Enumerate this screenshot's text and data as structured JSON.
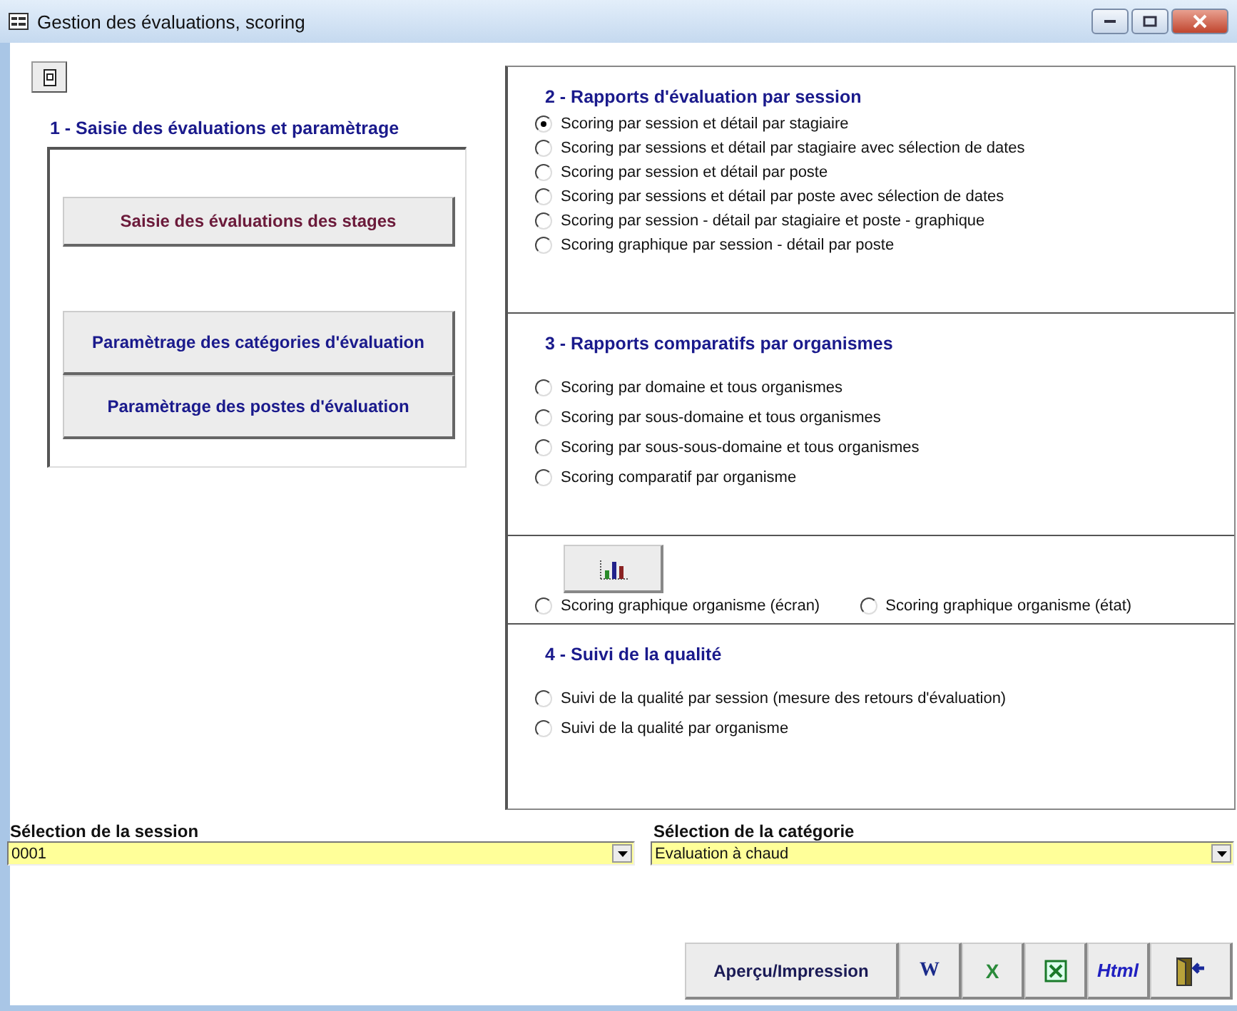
{
  "window": {
    "title": "Gestion des évaluations, scoring"
  },
  "left": {
    "title": "1 - Saisie des évaluations et paramètrage",
    "buttons": [
      {
        "label": "Saisie des évaluations des stages",
        "kind": "accent"
      },
      {
        "label": "Paramètrage des catégories d'évaluation",
        "kind": "normal"
      },
      {
        "label": "Paramètrage des postes d'évaluation",
        "kind": "normal"
      }
    ]
  },
  "sections": [
    {
      "kind": "list",
      "title": "2 - Rapports d'évaluation par session",
      "options": [
        {
          "label": "Scoring par session et détail par stagiaire",
          "selected": true
        },
        {
          "label": "Scoring par sessions et détail par stagiaire avec sélection de dates",
          "selected": false
        },
        {
          "label": "Scoring par session et détail par poste",
          "selected": false
        },
        {
          "label": "Scoring par sessions et détail par poste avec sélection de dates",
          "selected": false
        },
        {
          "label": "Scoring par session - détail par stagiaire et poste - graphique",
          "selected": false
        },
        {
          "label": "Scoring graphique par session - détail par poste",
          "selected": false
        }
      ]
    },
    {
      "kind": "list",
      "title": "3 - Rapports comparatifs par organismes",
      "options": [
        {
          "label": "Scoring par domaine et tous organismes",
          "selected": false
        },
        {
          "label": "Scoring par sous-domaine et tous organismes",
          "selected": false
        },
        {
          "label": "Scoring par sous-sous-domaine et tous organismes",
          "selected": false
        },
        {
          "label": "Scoring comparatif par organisme",
          "selected": false
        }
      ]
    },
    {
      "kind": "graph",
      "options": [
        {
          "label": "Scoring graphique organisme (écran)",
          "selected": false
        },
        {
          "label": "Scoring graphique organisme (état)",
          "selected": false
        }
      ]
    },
    {
      "kind": "list",
      "title": "4 - Suivi de la qualité",
      "options": [
        {
          "label": "Suivi de la qualité par session (mesure des retours d'évaluation)",
          "selected": false
        },
        {
          "label": "Suivi de la qualité par organisme",
          "selected": false
        }
      ]
    }
  ],
  "selects": [
    {
      "label": "Sélection de la session",
      "value": "0001"
    },
    {
      "label": "Sélection de la catégorie",
      "value": "Evaluation à chaud"
    }
  ],
  "actions": [
    {
      "kind": "text",
      "label": "Aperçu/Impression"
    },
    {
      "kind": "word",
      "label": "W"
    },
    {
      "kind": "excel-letter",
      "label": "X"
    },
    {
      "kind": "excel-sheet"
    },
    {
      "kind": "html",
      "label": "Html"
    },
    {
      "kind": "exit"
    }
  ]
}
